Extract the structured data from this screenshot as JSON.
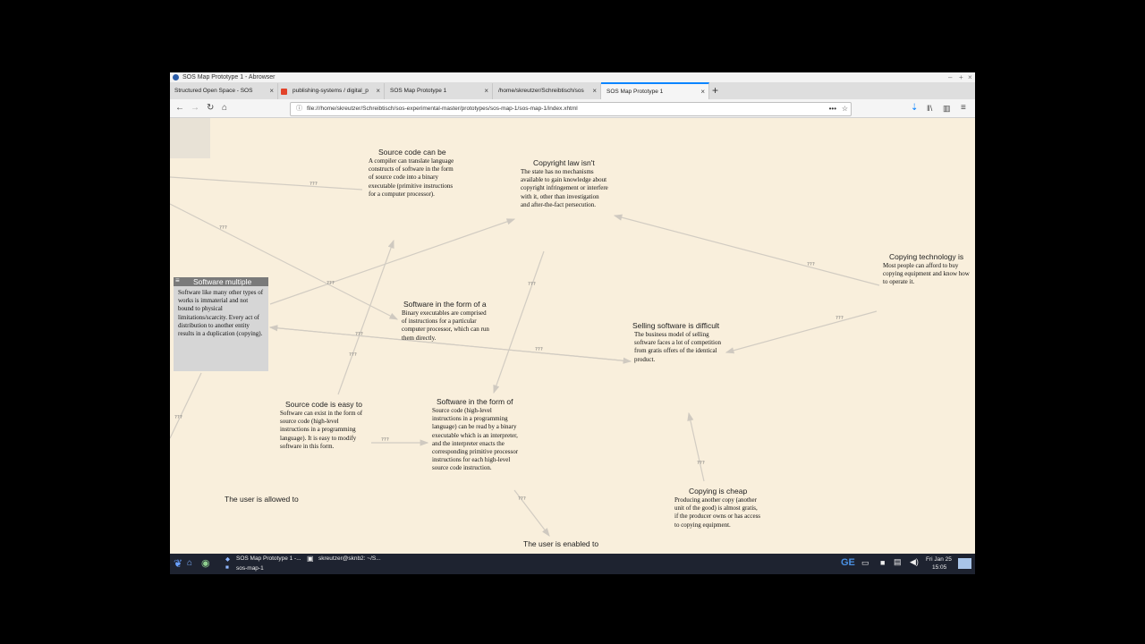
{
  "window": {
    "title": "SOS Map Prototype 1 - Abrowser"
  },
  "tabs": [
    {
      "label": "Structured Open Space - SOS",
      "active": false
    },
    {
      "label": "publishing-systems / digital_p",
      "active": false
    },
    {
      "label": "SOS Map Prototype 1",
      "active": false
    },
    {
      "label": "/home/skreutzer/Schreibtisch/sos",
      "active": false
    },
    {
      "label": "SOS Map Prototype 1",
      "active": true
    }
  ],
  "address_bar": {
    "url": "file:///home/skreutzer/Schreibtisch/sos-experimental-master/prototypes/sos-map-1/sos-map-1/index.xhtml"
  },
  "nodes": [
    {
      "id": "software-multiple",
      "title": "Software multiple",
      "body": "Software like many other types of works is immaterial and not bound to physical limitations/scarcity. Every act of distribution to another entity results in a duplication (copying)."
    },
    {
      "id": "source-code-can-be",
      "title": "Source code can be",
      "body": "A compiler can translate language constructs of software in the form of source code into a binary executable (primitive instructions for a computer processor)."
    },
    {
      "id": "copyright-law",
      "title": "Copyright law isn't",
      "body": "The state has no mechanisms available to gain knowledge about copyright infringement or interfere with it, other than investigation and after-the-fact persecution."
    },
    {
      "id": "copying-technology",
      "title": "Copying technology is",
      "body": "Most people can afford to buy copying equipment and know how to operate it."
    },
    {
      "id": "software-binary",
      "title": "Software in the form of a",
      "body": "Binary executables are comprised of instructions for a particular computer processor, which can run them directly."
    },
    {
      "id": "selling-software",
      "title": "Selling software is difficult",
      "body": "The business model of selling software faces a lot of competition from gratis offers of the identical product."
    },
    {
      "id": "source-code-easy",
      "title": "Source code is easy to",
      "body": "Software can exist in the form of source code (high-level instructions in a programming language). It is easy to modify software in this form."
    },
    {
      "id": "software-source",
      "title": "Software in the form of",
      "body": "Source code (high-level instructions in a programming language) can be read by a binary executable which is an interpreter, and the interpreter enacts the corresponding primitive processor instructions for each high-level source code instruction."
    },
    {
      "id": "copying-cheap",
      "title": "Copying is cheap",
      "body": "Producing another copy (another unit of the good) is almost gratis, if the producer owns or has access to copying equipment."
    },
    {
      "id": "user-allowed",
      "title": "The user is allowed to",
      "body": ""
    },
    {
      "id": "user-enabled",
      "title": "The user is enabled to",
      "body": ""
    }
  ],
  "edge_label": "???",
  "taskbar": {
    "items": [
      {
        "label": "SOS Map Prototype 1 -..."
      },
      {
        "label": "sos-map-1"
      },
      {
        "label": "skreutzer@sknb2: ~/S..."
      }
    ],
    "lang": "GE",
    "date": "Fri Jan 25",
    "time": "15:05"
  },
  "colors": {
    "canvas": "#f9efdc",
    "edge": "#cfc9c0",
    "selected_node": "#d6d6d6",
    "accent": "#0a84ff"
  }
}
